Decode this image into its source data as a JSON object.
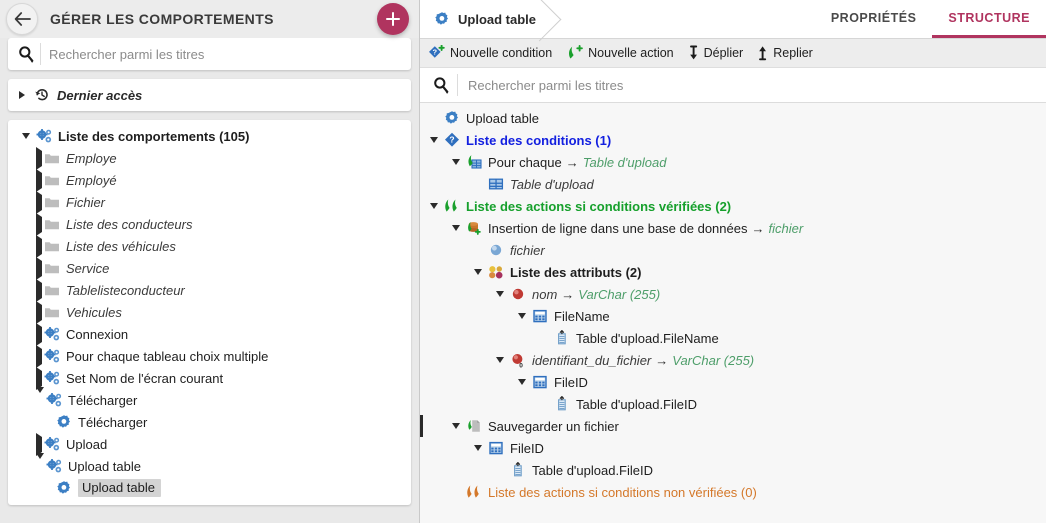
{
  "left_panel": {
    "title": "GÉRER LES COMPORTEMENTS",
    "back_icon": "arrow-left-icon",
    "add_icon": "plus-icon",
    "accent_color": "#b0345f",
    "search": {
      "placeholder": "Rechercher parmi les titres",
      "value": "",
      "icon": "search-icon"
    },
    "recent": {
      "label": "Dernier accès",
      "icon": "history-icon",
      "expanded": false
    },
    "tree": {
      "root": {
        "label": "Liste des comportements (105)",
        "icon": "gears-icon",
        "expanded": true
      },
      "items": [
        {
          "label": "Employe",
          "icon": "folder-icon",
          "depth": 1,
          "expanded": false,
          "italic": true,
          "has_twisty": true
        },
        {
          "label": "Employé",
          "icon": "folder-icon",
          "depth": 1,
          "expanded": false,
          "italic": true,
          "has_twisty": true
        },
        {
          "label": "Fichier",
          "icon": "folder-icon",
          "depth": 1,
          "expanded": false,
          "italic": true,
          "has_twisty": true
        },
        {
          "label": "Liste des conducteurs",
          "icon": "folder-icon",
          "depth": 1,
          "expanded": false,
          "italic": true,
          "has_twisty": true
        },
        {
          "label": "Liste des véhicules",
          "icon": "folder-icon",
          "depth": 1,
          "expanded": false,
          "italic": true,
          "has_twisty": true
        },
        {
          "label": "Service",
          "icon": "folder-icon",
          "depth": 1,
          "expanded": false,
          "italic": true,
          "has_twisty": true
        },
        {
          "label": "Tablelisteconducteur",
          "icon": "folder-icon",
          "depth": 1,
          "expanded": false,
          "italic": true,
          "has_twisty": true
        },
        {
          "label": "Vehicules",
          "icon": "folder-icon",
          "depth": 1,
          "expanded": false,
          "italic": true,
          "has_twisty": true
        },
        {
          "label": "Connexion",
          "icon": "gears-icon",
          "depth": 1,
          "expanded": false,
          "italic": false,
          "has_twisty": true
        },
        {
          "label": "Pour chaque tableau choix multiple",
          "icon": "gears-icon",
          "depth": 1,
          "expanded": false,
          "italic": false,
          "has_twisty": true
        },
        {
          "label": "Set Nom de l'écran courant",
          "icon": "gears-icon",
          "depth": 1,
          "expanded": false,
          "italic": false,
          "has_twisty": true
        },
        {
          "label": "Télécharger",
          "icon": "gears-icon",
          "depth": 1,
          "expanded": true,
          "italic": false,
          "has_twisty": true
        },
        {
          "label": "Télécharger",
          "icon": "gear-icon",
          "depth": 2,
          "expanded": false,
          "italic": false,
          "has_twisty": false
        },
        {
          "label": "Upload",
          "icon": "gears-icon",
          "depth": 1,
          "expanded": false,
          "italic": false,
          "has_twisty": true
        },
        {
          "label": "Upload table",
          "icon": "gears-icon",
          "depth": 1,
          "expanded": true,
          "italic": false,
          "has_twisty": true
        },
        {
          "label": "Upload table",
          "icon": "gear-icon",
          "depth": 2,
          "expanded": false,
          "italic": false,
          "has_twisty": false,
          "selected": true
        }
      ]
    }
  },
  "right_panel": {
    "breadcrumb": {
      "label": "Upload table",
      "icon": "gear-icon"
    },
    "tabs": [
      {
        "label": "PROPRIÉTÉS",
        "active": false
      },
      {
        "label": "STRUCTURE",
        "active": true
      }
    ],
    "active_tab_color": "#b0345f",
    "toolbar": [
      {
        "label": "Nouvelle condition",
        "icon": "new-condition-icon"
      },
      {
        "label": "Nouvelle action",
        "icon": "new-action-icon"
      },
      {
        "label": "Déplier",
        "icon": "expand-down-icon"
      },
      {
        "label": "Replier",
        "icon": "collapse-up-icon"
      }
    ],
    "search": {
      "placeholder": "Rechercher parmi les titres",
      "value": "",
      "icon": "search-icon"
    },
    "tree": [
      {
        "id": "r0",
        "depth": 0,
        "twisty": "none",
        "icon": "gear-icon",
        "text": "Upload table",
        "style": "plain"
      },
      {
        "id": "r1",
        "depth": 0,
        "twisty": "down",
        "icon": "condition-icon",
        "text": "Liste des conditions (1)",
        "style": "blue-link"
      },
      {
        "id": "r2",
        "depth": 1,
        "twisty": "down",
        "icon": "foreach-icon",
        "text": "Pour chaque",
        "arrow": "→",
        "suffix": "Table d'upload",
        "style": "plain-green-suffix"
      },
      {
        "id": "r3",
        "depth": 2,
        "twisty": "none",
        "icon": "table-icon",
        "text": "Table d'upload",
        "style": "italic"
      },
      {
        "id": "r4",
        "depth": 0,
        "twisty": "down",
        "icon": "actions-icon",
        "text": "Liste des actions si conditions vérifiées (2)",
        "style": "green-link"
      },
      {
        "id": "r5",
        "depth": 1,
        "twisty": "down",
        "icon": "db-insert-icon",
        "text": "Insertion de ligne dans une base de données",
        "arrow": "→",
        "suffix": "fichier",
        "style": "plain-green-suffix"
      },
      {
        "id": "r6",
        "depth": 2,
        "twisty": "none",
        "icon": "sphere-blue-icon",
        "text": "fichier",
        "style": "italic"
      },
      {
        "id": "r7",
        "depth": 2,
        "twisty": "down",
        "icon": "attributes-icon",
        "text": "Liste des attributs (2)",
        "style": "bold"
      },
      {
        "id": "r8",
        "depth": 3,
        "twisty": "down",
        "icon": "sphere-red-icon",
        "text": "nom",
        "arrow": "→",
        "suffix": "VarChar (255)",
        "style": "italic-green-suffix"
      },
      {
        "id": "r9",
        "depth": 4,
        "twisty": "down",
        "icon": "field-icon",
        "text": "FileName",
        "style": "plain"
      },
      {
        "id": "r10",
        "depth": 5,
        "twisty": "none",
        "icon": "column-icon",
        "text": "Table d'upload.FileName",
        "style": "plain"
      },
      {
        "id": "r11",
        "depth": 3,
        "twisty": "down",
        "icon": "sphere-red0-icon",
        "text": "identifiant_du_fichier",
        "arrow": "→",
        "suffix": "VarChar (255)",
        "style": "italic-green-suffix"
      },
      {
        "id": "r12",
        "depth": 4,
        "twisty": "down",
        "icon": "field-icon",
        "text": "FileID",
        "style": "plain"
      },
      {
        "id": "r13",
        "depth": 5,
        "twisty": "none",
        "icon": "column-icon",
        "text": "Table d'upload.FileID",
        "style": "plain"
      },
      {
        "id": "r14",
        "depth": 1,
        "twisty": "down",
        "icon": "save-file-icon",
        "text": "Sauvegarder un fichier",
        "style": "plain",
        "marker": true
      },
      {
        "id": "r15",
        "depth": 2,
        "twisty": "down",
        "icon": "field-icon",
        "text": "FileID",
        "style": "plain"
      },
      {
        "id": "r16",
        "depth": 3,
        "twisty": "none",
        "icon": "column-icon",
        "text": "Table d'upload.FileID",
        "style": "plain"
      },
      {
        "id": "r17",
        "depth": 1,
        "twisty": "none",
        "icon": "actions-orange-icon",
        "text": "Liste des actions si conditions non vérifiées (0)",
        "style": "orange-link"
      }
    ]
  }
}
